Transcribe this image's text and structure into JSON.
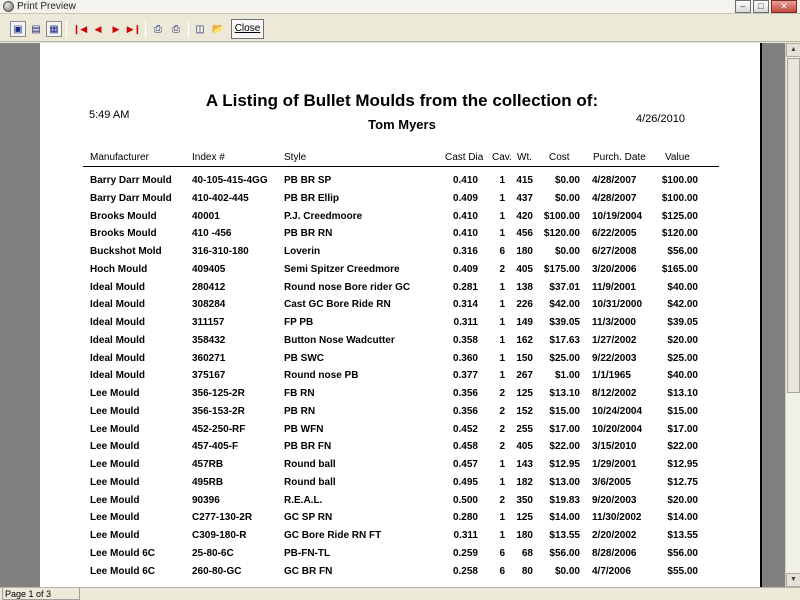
{
  "window": {
    "title": "Print Preview"
  },
  "toolbar": {
    "close_label": "Close"
  },
  "status": {
    "page": "Page 1 of 3"
  },
  "report": {
    "title": "A Listing of Bullet Moulds from the collection of:",
    "owner": "Tom Myers",
    "time": "5:49 AM",
    "date": "4/26/2010",
    "columns": [
      "Manufacturer",
      "Index #",
      "Style",
      "Cast Dia",
      "Cav.",
      "Wt.",
      "Cost",
      "Purch. Date",
      "Value"
    ],
    "rows": [
      [
        "Barry Darr Mould",
        "40-105-415-4GG",
        "PB BR SP",
        "0.410",
        "1",
        "415",
        "$0.00",
        "4/28/2007",
        "$100.00"
      ],
      [
        "Barry Darr Mould",
        "410-402-445",
        "PB BR Ellip",
        "0.409",
        "1",
        "437",
        "$0.00",
        "4/28/2007",
        "$100.00"
      ],
      [
        "Brooks Mould",
        "40001",
        "P.J. Creedmoore",
        "0.410",
        "1",
        "420",
        "$100.00",
        "10/19/2004",
        "$125.00"
      ],
      [
        "Brooks Mould",
        "410 -456",
        "PB BR RN",
        "0.410",
        "1",
        "456",
        "$120.00",
        "6/22/2005",
        "$120.00"
      ],
      [
        "Buckshot Mold",
        "316-310-180",
        "Loverin",
        "0.316",
        "6",
        "180",
        "$0.00",
        "6/27/2008",
        "$56.00"
      ],
      [
        "Hoch Mould",
        "409405",
        "Semi Spitzer Creedmore",
        "0.409",
        "2",
        "405",
        "$175.00",
        "3/20/2006",
        "$165.00"
      ],
      [
        "Ideal Mould",
        "280412",
        "Round nose Bore rider GC",
        "0.281",
        "1",
        "138",
        "$37.01",
        "11/9/2001",
        "$40.00"
      ],
      [
        "Ideal Mould",
        "308284",
        "Cast GC Bore Ride RN",
        "0.314",
        "1",
        "226",
        "$42.00",
        "10/31/2000",
        "$42.00"
      ],
      [
        "Ideal Mould",
        "311157",
        "FP PB",
        "0.311",
        "1",
        "149",
        "$39.05",
        "11/3/2000",
        "$39.05"
      ],
      [
        "Ideal Mould",
        "358432",
        "Button Nose Wadcutter",
        "0.358",
        "1",
        "162",
        "$17.63",
        "1/27/2002",
        "$20.00"
      ],
      [
        "Ideal Mould",
        "360271",
        "PB SWC",
        "0.360",
        "1",
        "150",
        "$25.00",
        "9/22/2003",
        "$25.00"
      ],
      [
        "Ideal Mould",
        "375167",
        "Round nose PB",
        "0.377",
        "1",
        "267",
        "$1.00",
        "1/1/1965",
        "$40.00"
      ],
      [
        "Lee Mould",
        "356-125-2R",
        "FB RN",
        "0.356",
        "2",
        "125",
        "$13.10",
        "8/12/2002",
        "$13.10"
      ],
      [
        "Lee Mould",
        "356-153-2R",
        "PB RN",
        "0.356",
        "2",
        "152",
        "$15.00",
        "10/24/2004",
        "$15.00"
      ],
      [
        "Lee Mould",
        "452-250-RF",
        "PB WFN",
        "0.452",
        "2",
        "255",
        "$17.00",
        "10/20/2004",
        "$17.00"
      ],
      [
        "Lee Mould",
        "457-405-F",
        "PB BR FN",
        "0.458",
        "2",
        "405",
        "$22.00",
        "3/15/2010",
        "$22.00"
      ],
      [
        "Lee Mould",
        "457RB",
        "Round ball",
        "0.457",
        "1",
        "143",
        "$12.95",
        "1/29/2001",
        "$12.95"
      ],
      [
        "Lee Mould",
        "495RB",
        "Round ball",
        "0.495",
        "1",
        "182",
        "$13.00",
        "3/6/2005",
        "$12.75"
      ],
      [
        "Lee Mould",
        "90396",
        "R.E.A.L.",
        "0.500",
        "2",
        "350",
        "$19.83",
        "9/20/2003",
        "$20.00"
      ],
      [
        "Lee Mould",
        "C277-130-2R",
        "GC SP RN",
        "0.280",
        "1",
        "125",
        "$14.00",
        "11/30/2002",
        "$14.00"
      ],
      [
        "Lee Mould",
        "C309-180-R",
        "GC Bore Ride RN FT",
        "0.311",
        "1",
        "180",
        "$13.55",
        "2/20/2002",
        "$13.55"
      ],
      [
        "Lee Mould 6C",
        "25-80-6C",
        "PB-FN-TL",
        "0.259",
        "6",
        "68",
        "$56.00",
        "8/28/2006",
        "$56.00"
      ],
      [
        "Lee Mould 6C",
        "260-80-GC",
        "GC BR FN",
        "0.258",
        "6",
        "80",
        "$0.00",
        "4/7/2006",
        "$55.00"
      ]
    ]
  },
  "icons": [
    "one-page-icon",
    "two-page-icon",
    "multi-page-icon",
    "first-page-icon",
    "prev-page-icon",
    "next-page-icon",
    "last-page-icon",
    "print-setup-icon",
    "print-icon",
    "save-icon",
    "open-icon"
  ]
}
